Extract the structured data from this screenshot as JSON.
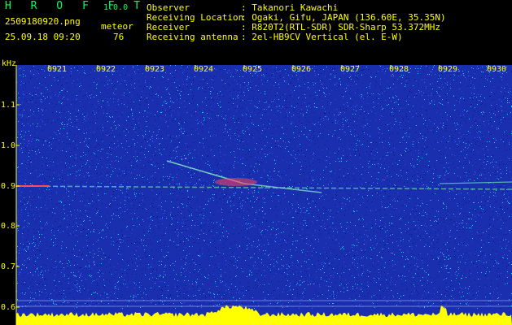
{
  "header": {
    "app_name": "H R O F F T",
    "version": "1.0.0",
    "filename": "2509180920.png",
    "datetime": "25.09.18 09:20",
    "meteor_label": "meteor",
    "meteor_count": "76"
  },
  "info": [
    {
      "key": "Observer",
      "value": ": Takanori Kawachi"
    },
    {
      "key": "Receiving Location",
      "value": ": Ogaki, Gifu, JAPAN (136.60E, 35.35N)"
    },
    {
      "key": "Receiver",
      "value": ": R820T2(RTL-SDR) SDR-Sharp 53.372MHz"
    },
    {
      "key": "Receiving antenna",
      "value": ": 2el-HB9CV Vertical (el. E-W)"
    }
  ],
  "axis": {
    "y_unit": "kHz",
    "x_ticks": [
      "0921",
      "0922",
      "0923",
      "0924",
      "0925",
      "0926",
      "0927",
      "0928",
      "0929",
      "0930"
    ],
    "y_ticks": [
      "1.1",
      "1.0",
      "0.9",
      "0.8",
      "0.7",
      "0.6"
    ]
  },
  "colors": {
    "background": "#000000",
    "noise": "#1a2fb0",
    "text": "#ffff00",
    "logo": "#00ff66"
  }
}
